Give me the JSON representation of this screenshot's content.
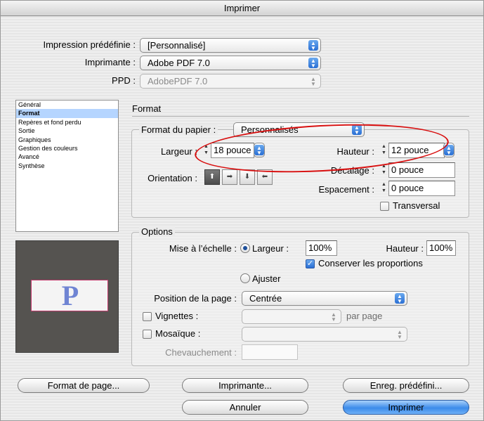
{
  "window": {
    "title": "Imprimer"
  },
  "top": {
    "preset_label": "Impression prédéfinie :",
    "preset_value": "[Personnalisé]",
    "printer_label": "Imprimante :",
    "printer_value": "Adobe PDF 7.0",
    "ppd_label": "PPD :",
    "ppd_value": "AdobePDF 7.0"
  },
  "sidebar": {
    "items": [
      {
        "label": "Général"
      },
      {
        "label": "Format"
      },
      {
        "label": "Repères et fond perdu"
      },
      {
        "label": "Sortie"
      },
      {
        "label": "Graphiques"
      },
      {
        "label": "Gestion des couleurs"
      },
      {
        "label": "Avancé"
      },
      {
        "label": "Synthèse"
      }
    ],
    "selected": "Format"
  },
  "preview": {
    "letter": "P"
  },
  "format": {
    "section_title": "Format",
    "paper_size_label": "Format du papier :",
    "paper_size_value": "Personnalisés",
    "width_label": "Largeur :",
    "width_value": "18 pouce",
    "height_label": "Hauteur :",
    "height_value": "12 pouce",
    "offset_label": "Décalage :",
    "offset_value": "0 pouce",
    "spacing_label": "Espacement :",
    "spacing_value": "0 pouce",
    "orientation_label": "Orientation :",
    "transverse_label": "Transversal",
    "transverse_checked": false
  },
  "options": {
    "title": "Options",
    "scale_label": "Mise à l’échelle :",
    "scale_width_label": "Largeur :",
    "scale_width_value": "100%",
    "scale_height_label": "Hauteur :",
    "scale_height_value": "100%",
    "keep_proportions_label": "Conserver les proportions",
    "keep_proportions_checked": true,
    "fit_label": "Ajuster",
    "page_position_label": "Position de la page :",
    "page_position_value": "Centrée",
    "thumbnails_label": "Vignettes :",
    "per_page_label": "par page",
    "tile_label": "Mosaïque :",
    "overlap_label": "Chevauchement :"
  },
  "buttons": {
    "page_setup": "Format de page...",
    "printer": "Imprimante...",
    "save_preset": "Enreg. prédéfini...",
    "cancel": "Annuler",
    "print": "Imprimer"
  },
  "colors": {
    "annotation": "#d80f0f",
    "selection": "#b5d5ff",
    "default_button": "#3c8bea"
  }
}
